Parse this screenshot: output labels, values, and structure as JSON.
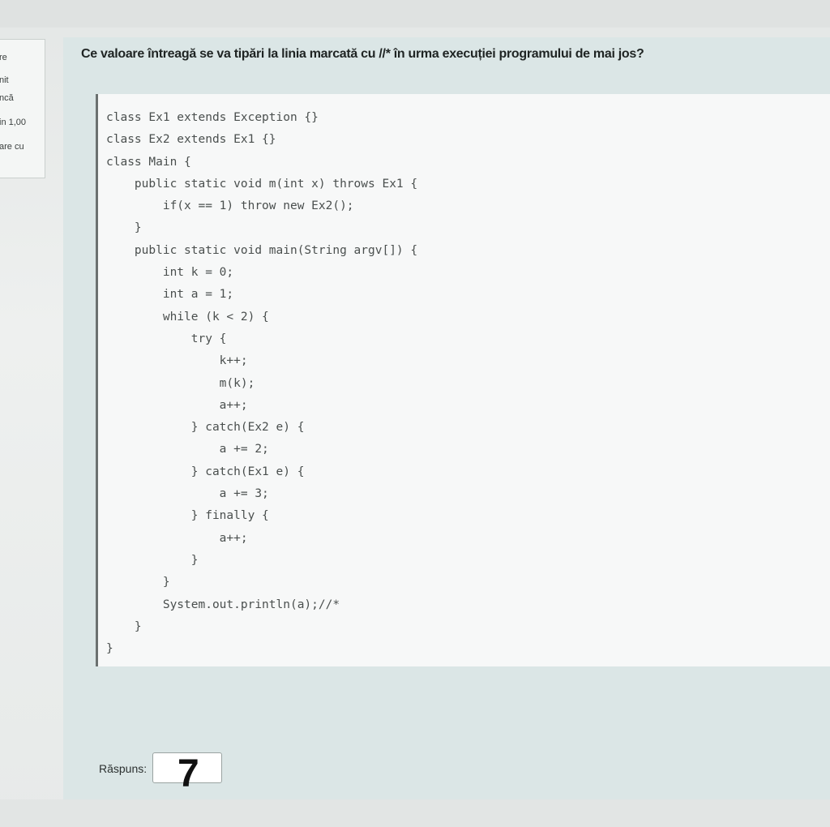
{
  "sidebar": {
    "lines": [
      "re",
      "nit",
      "ncă",
      "in 1,00",
      "are cu"
    ]
  },
  "question": {
    "text": "Ce valoare întreagă se va tipări la linia marcată cu //* în urma execuției programului de mai jos?"
  },
  "code": {
    "lines": [
      "class Ex1 extends Exception {}",
      "class Ex2 extends Ex1 {}",
      "class Main {",
      "    public static void m(int x) throws Ex1 {",
      "        if(x == 1) throw new Ex2();",
      "    }",
      "    public static void main(String argv[]) {",
      "        int k = 0;",
      "        int a = 1;",
      "        while (k < 2) {",
      "            try {",
      "                k++;",
      "                m(k);",
      "                a++;",
      "            } catch(Ex2 e) {",
      "                a += 2;",
      "            } catch(Ex1 e) {",
      "                a += 3;",
      "            } finally {",
      "                a++;",
      "            }",
      "        }",
      "        System.out.println(a);//*",
      "    }",
      "}"
    ]
  },
  "answer": {
    "label": "Răspuns:",
    "value": "7"
  }
}
